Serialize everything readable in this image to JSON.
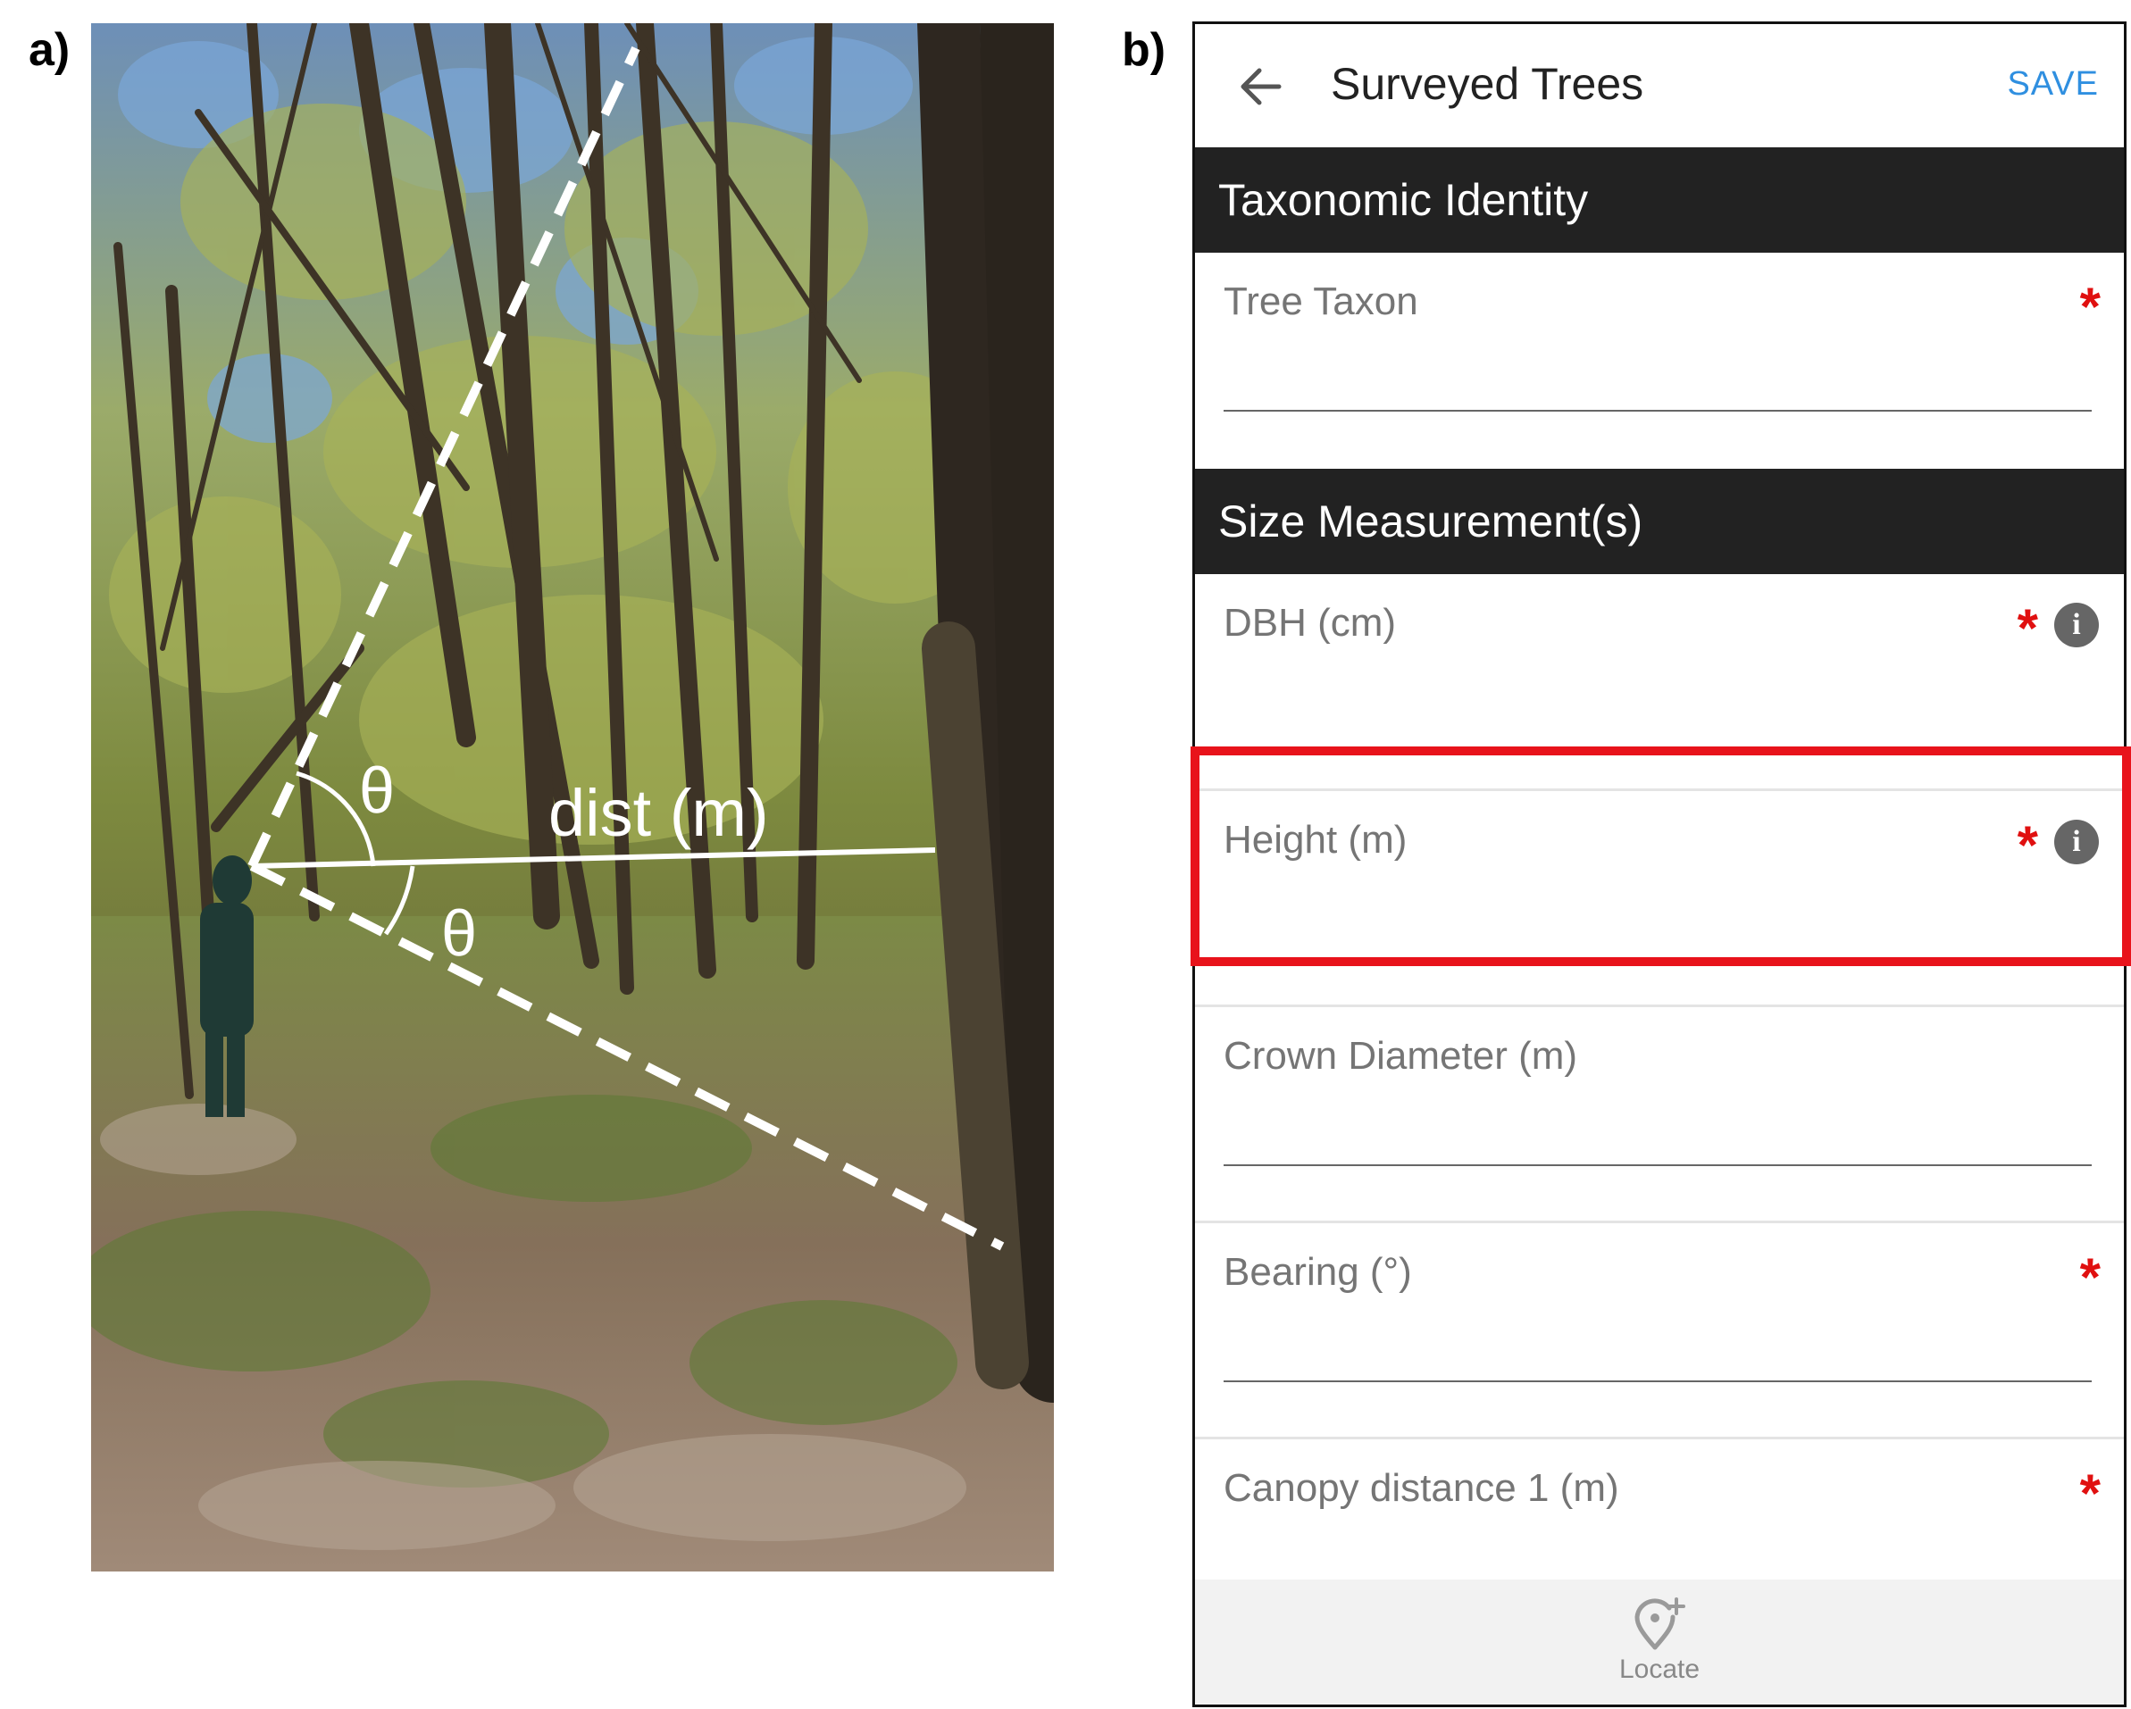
{
  "panel_a": {
    "label": "a)",
    "annotations": {
      "angle_top": "θ",
      "angle_bottom": "θ",
      "distance": "dist (m)"
    }
  },
  "panel_b": {
    "label": "b)",
    "appbar": {
      "title": "Surveyed Trees",
      "save_label": "SAVE",
      "back_icon": "arrow-left-icon"
    },
    "sections": [
      {
        "header": "Taxonomic Identity",
        "fields": [
          {
            "label": "Tree Taxon",
            "required": true,
            "info": false,
            "value": ""
          }
        ]
      },
      {
        "header": "Size Measurement(s)",
        "fields": [
          {
            "label": "DBH (cm)",
            "required": true,
            "info": true,
            "value": ""
          },
          {
            "label": "Height (m)",
            "required": true,
            "info": true,
            "value": "",
            "highlighted": true
          },
          {
            "label": "Crown Diameter (m)",
            "required": false,
            "info": false,
            "value": ""
          },
          {
            "label": "Bearing (°)",
            "required": true,
            "info": false,
            "value": ""
          },
          {
            "label": "Canopy distance 1 (m)",
            "required": true,
            "info": false,
            "value": ""
          }
        ]
      }
    ],
    "required_marker": "*",
    "info_glyph": "i",
    "bottom_bar": {
      "locate_label": "Locate",
      "locate_icon": "map-pin-plus-icon"
    },
    "colors": {
      "accent": "#2f8fe0",
      "required": "#e01010",
      "highlight": "#e8131b",
      "section_bg": "#222222"
    }
  }
}
